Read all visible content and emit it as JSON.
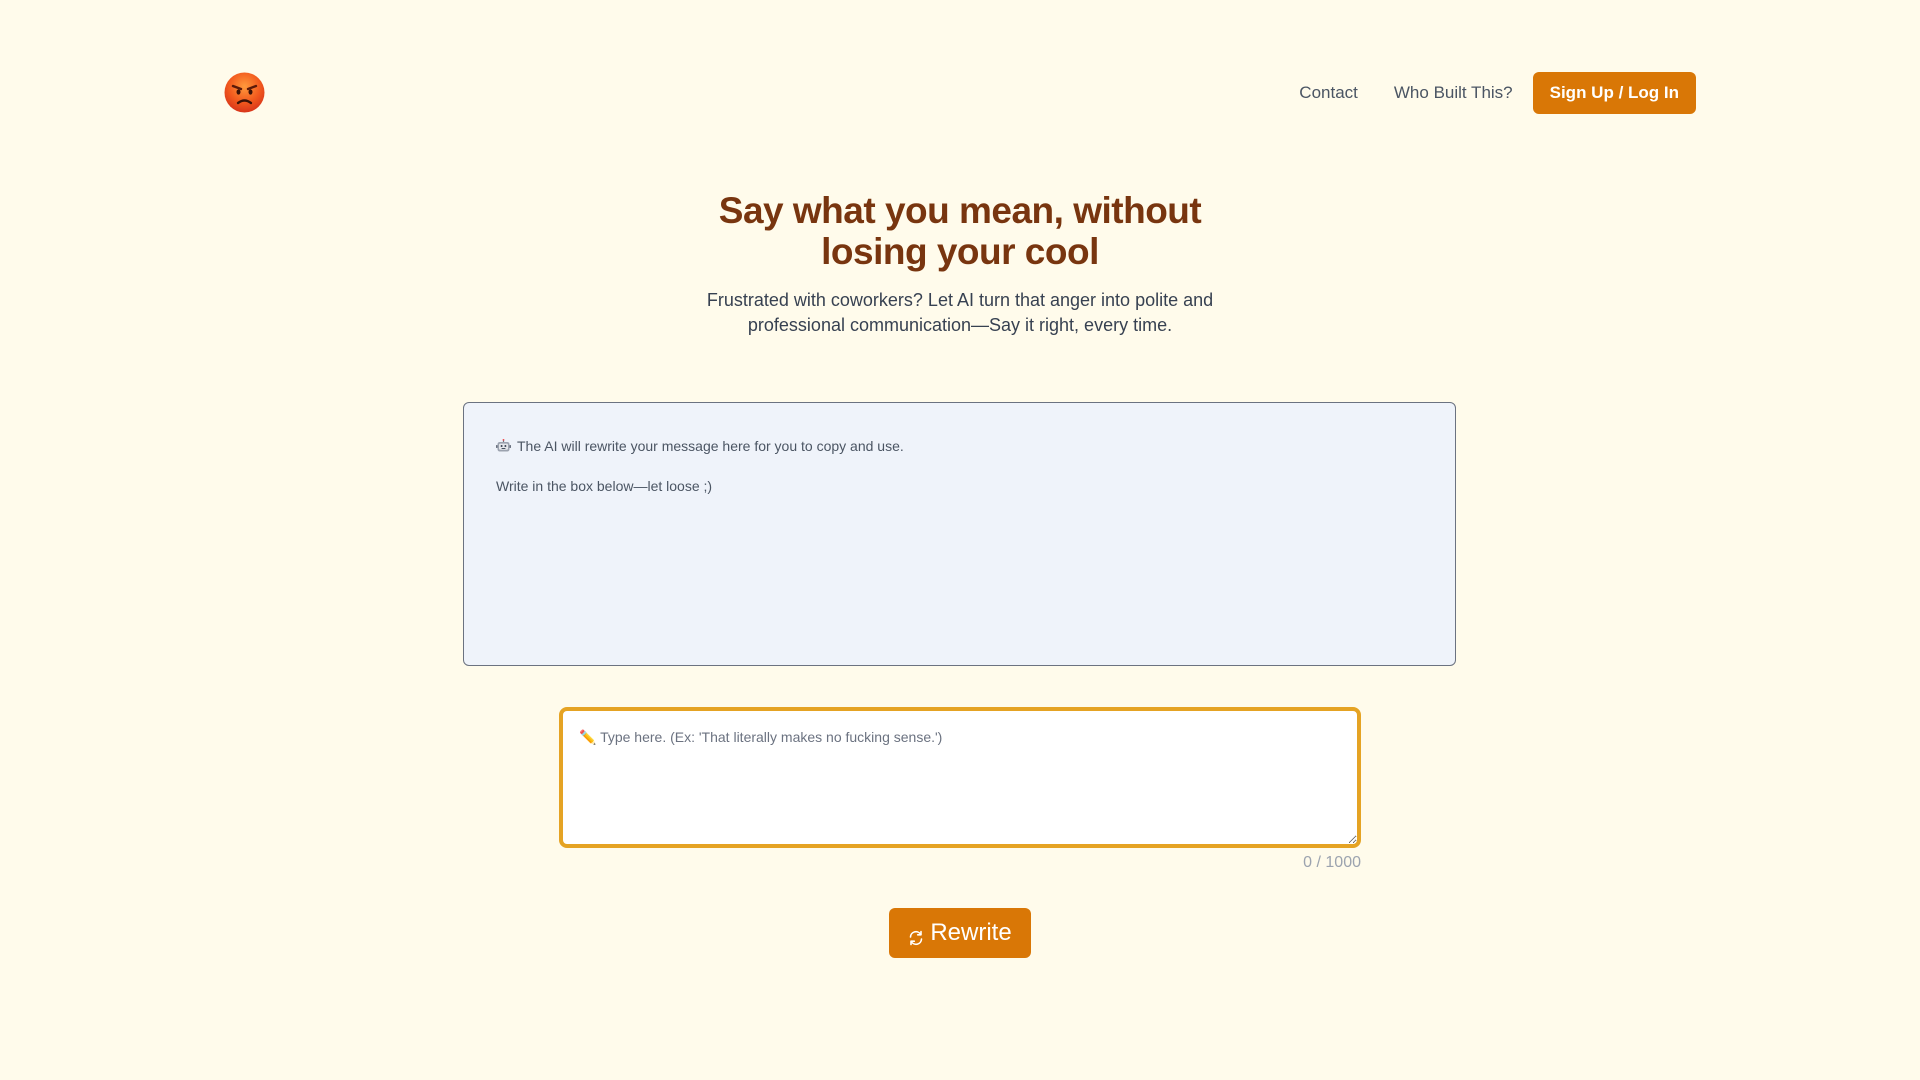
{
  "header": {
    "logo_icon": "angry-face-icon",
    "nav": {
      "contact": "Contact",
      "who_built": "Who Built This?",
      "signup": "Sign Up / Log In"
    }
  },
  "hero": {
    "title": "Say what you mean, without losing your cool",
    "subtitle": "Frustrated with coworkers? Let AI turn that anger into polite and professional communication—Say it right, every time."
  },
  "output": {
    "icon": "robot-icon",
    "line1": "The AI will rewrite your message here for you to copy and use.",
    "line2": "Write in the box below—let loose ;)"
  },
  "input": {
    "placeholder": "✏️ Type here. (Ex: 'That literally makes no fucking sense.')",
    "value": "",
    "char_count": "0 / 1000"
  },
  "rewrite_button": {
    "icon": "refresh-icon",
    "label": "Rewrite"
  },
  "colors": {
    "background": "#fffbeb",
    "accent": "#d97706",
    "title": "#78350f",
    "input_border": "#e5a323",
    "output_bg": "#eff3fa"
  }
}
